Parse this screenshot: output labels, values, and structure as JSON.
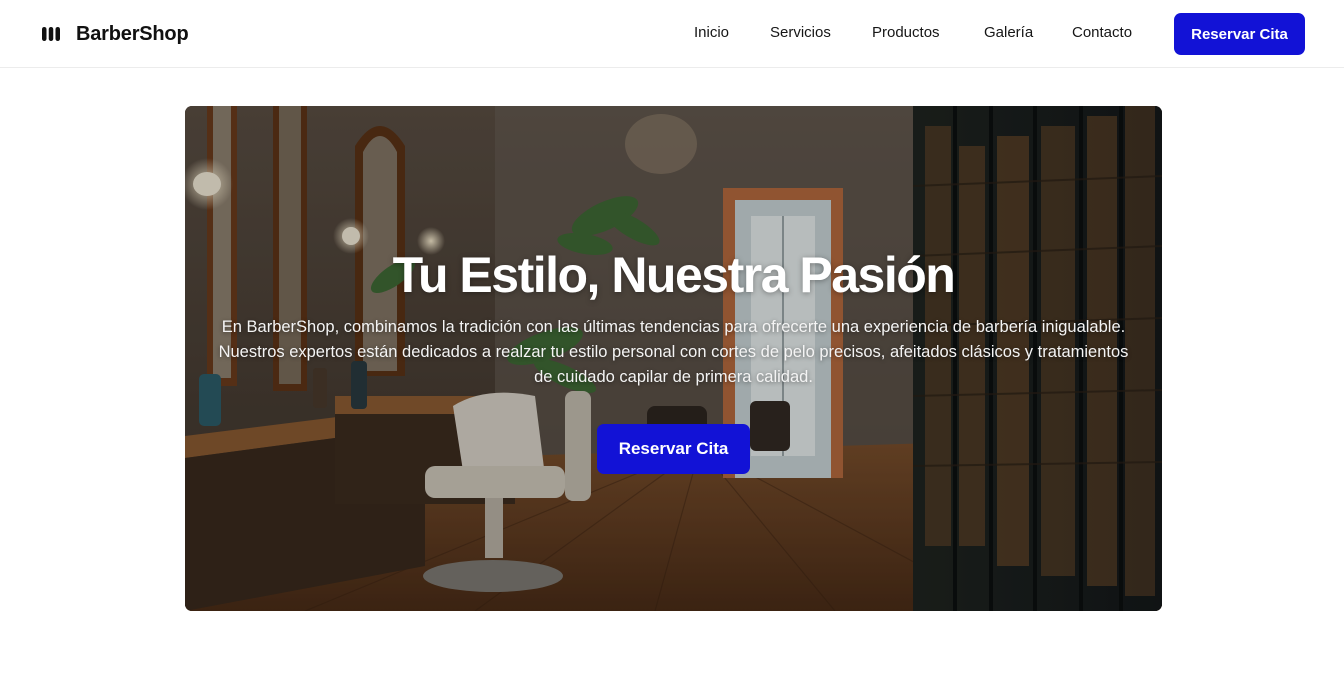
{
  "brand": {
    "name": "BarberShop",
    "logo_icon": "barbershop-logo-icon"
  },
  "nav": {
    "items": [
      {
        "label": "Inicio"
      },
      {
        "label": "Servicios"
      },
      {
        "label": "Productos"
      },
      {
        "label": "Galería"
      },
      {
        "label": "Contacto"
      }
    ],
    "cta_label": "Reservar Cita"
  },
  "hero": {
    "title": "Tu Estilo, Nuestra Pasión",
    "description": "En BarberShop, combinamos la tradición con las últimas tendencias para ofrecerte una experiencia de barbería inigualable. Nuestros expertos están dedicados a realzar tu estilo personal con cortes de pelo precisos, afeitados clásicos y tratamientos de cuidado capilar de primera calidad.",
    "cta_label": "Reservar Cita",
    "background_icon": "barbershop-interior-image"
  },
  "colors": {
    "accent": "#1212d6",
    "background": "#ffffff",
    "text": "#111111"
  }
}
